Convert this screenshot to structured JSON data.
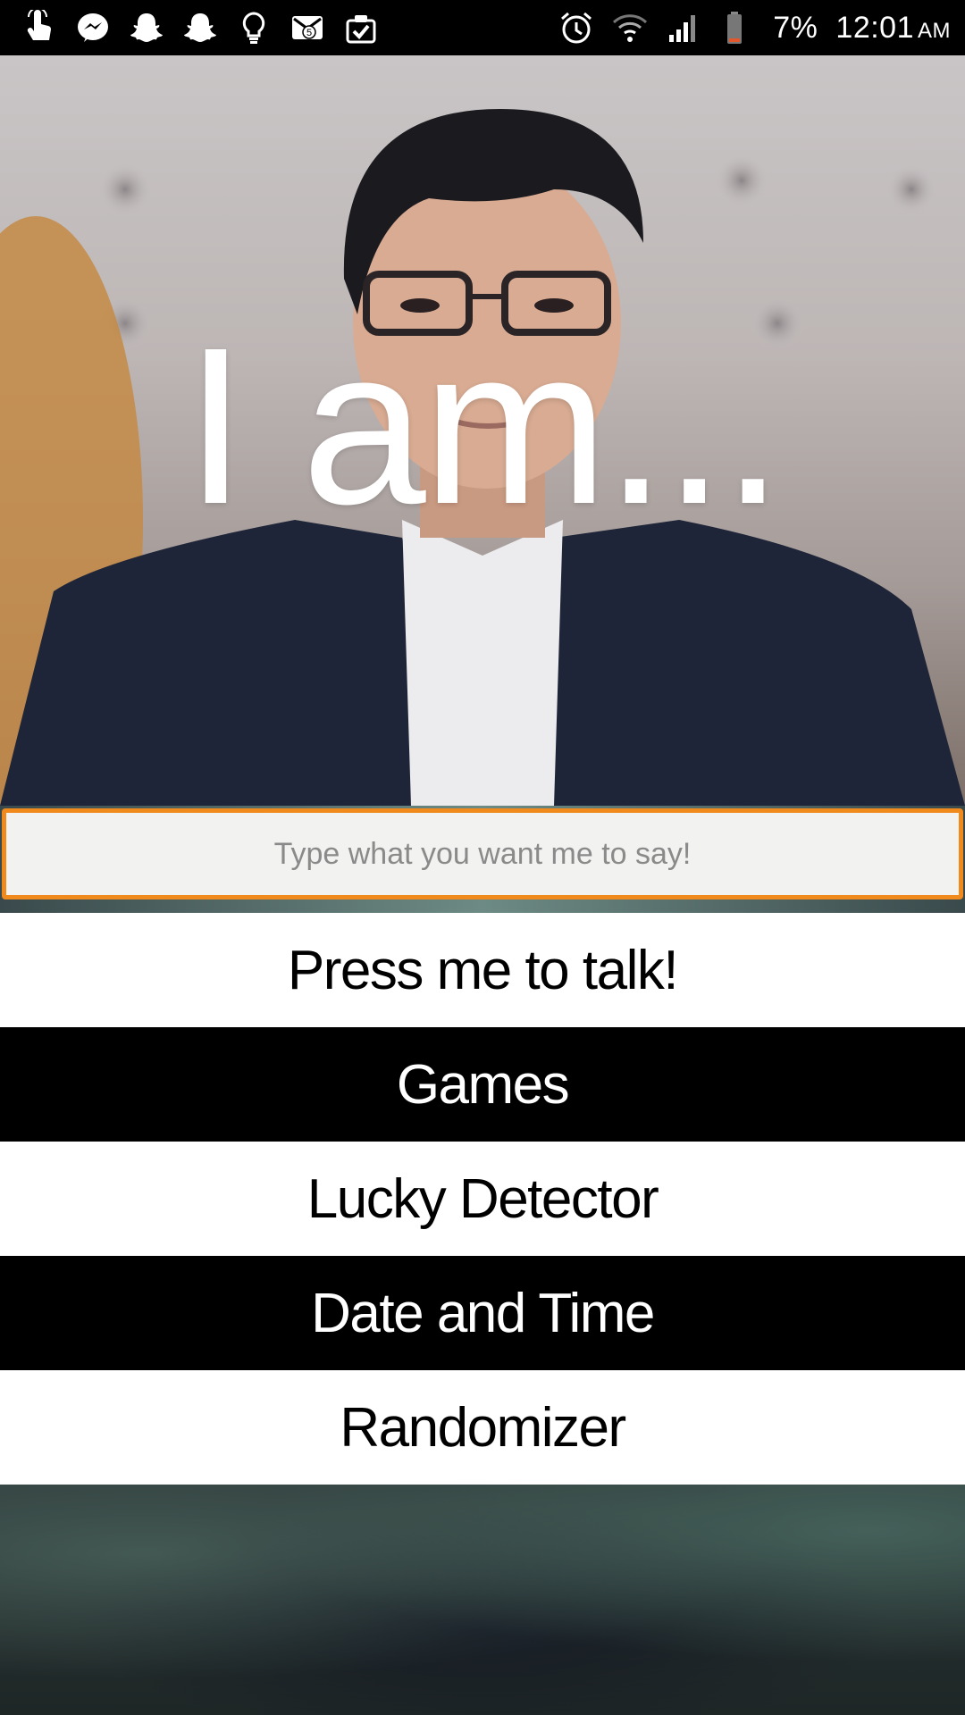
{
  "status_bar": {
    "notification_icons": [
      "touch-hand-icon",
      "messenger-icon",
      "snapchat-icon",
      "snapchat-icon",
      "lightbulb-icon",
      "gmail-icon",
      "clipboard-check-icon"
    ],
    "gmail_badge": "5",
    "battery_percent": "7%",
    "time": "12:01",
    "ampm": "AM"
  },
  "hero": {
    "title": "I am..."
  },
  "speech": {
    "placeholder": "Type what you want me to say!",
    "value": ""
  },
  "menu": {
    "talk_label": "Press me to talk!",
    "games_label": "Games",
    "lucky_label": "Lucky Detector",
    "datetime_label": "Date and Time",
    "randomizer_label": "Randomizer"
  },
  "colors": {
    "accent": "#f08a1c",
    "dark_button": "#000000",
    "light_button": "#ffffff"
  }
}
